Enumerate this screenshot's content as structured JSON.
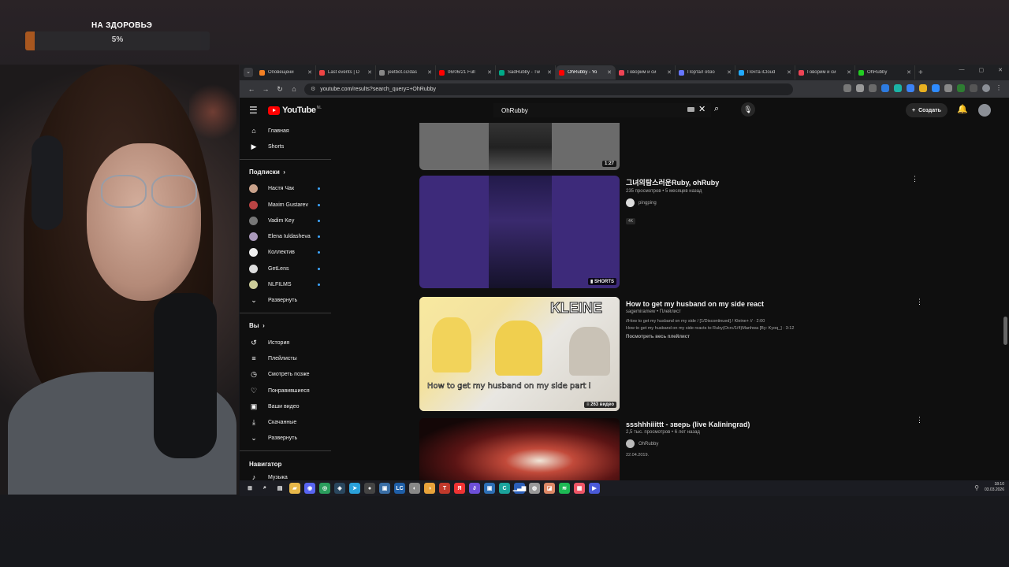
{
  "overlay": {
    "title": "НА ЗДОРОВЬЭ",
    "percent": "5%",
    "progress": 0.05,
    "accent": "#c9651e"
  },
  "browser": {
    "tabs": [
      {
        "label": "Оповещени",
        "color": "#f48024",
        "active": false
      },
      {
        "label": "Last events | D",
        "color": "#e44",
        "active": false
      },
      {
        "label": "jeetbot.cc/das",
        "color": "#888",
        "active": false
      },
      {
        "label": "06/06/21 Full",
        "color": "#f00",
        "active": false
      },
      {
        "label": "SadRubby - Tw",
        "color": "#0a8",
        "active": false
      },
      {
        "label": "OhRubby - Yo",
        "color": "#f00",
        "active": true
      },
      {
        "label": "Говорим и си",
        "color": "#e45",
        "active": false
      },
      {
        "label": "Портал обзо",
        "color": "#67f",
        "active": false
      },
      {
        "label": "Почта iCloud",
        "color": "#2af",
        "active": false
      },
      {
        "label": "Говорим и си",
        "color": "#e45",
        "active": false
      },
      {
        "label": "OhRubby",
        "color": "#2c2",
        "active": false
      }
    ],
    "url": "youtube.com/results?search_query=+OhRubby"
  },
  "youtube": {
    "logo": "YouTube",
    "region": "NL",
    "search_value": "OhRubby",
    "create_label": "Создать",
    "sidebar": {
      "top": [
        {
          "icon": "⌂",
          "label": "Главная"
        },
        {
          "icon": "▶",
          "label": "Shorts"
        }
      ],
      "subs_header": "Подписки",
      "subs": [
        {
          "label": "Настя Чак",
          "color": "#c9a28b"
        },
        {
          "label": "Maxim Gustarev",
          "color": "#b44"
        },
        {
          "label": "Vadim Key",
          "color": "#777"
        },
        {
          "label": "Elena Iuldasheva",
          "color": "#a9b"
        },
        {
          "label": "Коллектив",
          "color": "#eee"
        },
        {
          "label": "GetLens",
          "color": "#ddd"
        },
        {
          "label": "NLFILMS",
          "color": "#cc9"
        }
      ],
      "expand": "Развернуть",
      "you_header": "Вы",
      "you": [
        {
          "icon": "↺",
          "label": "История"
        },
        {
          "icon": "≡",
          "label": "Плейлисты"
        },
        {
          "icon": "◷",
          "label": "Смотреть позже"
        },
        {
          "icon": "♡",
          "label": "Понравившиеся"
        },
        {
          "icon": "▣",
          "label": "Ваши видео"
        },
        {
          "icon": "⤓",
          "label": "Скачанные"
        }
      ],
      "expand2": "Развернуть",
      "nav_header": "Навигатор",
      "nav_item": "Музыка"
    },
    "results": [
      {
        "duration": "1:27"
      },
      {
        "title": "그녀의탐스러운Ruby, ohRuby",
        "meta": "235 просмотров • 5 месяцев назад",
        "channel": "pingping",
        "badge": "4K",
        "duration": "SHORTS"
      },
      {
        "title": "How to get my husband on my side react",
        "meta": "sagemiramew • Плейлист",
        "line1": "//How to get my husband on my side / [1/Discontinued] / Kleine+ // · 2:00",
        "line2": "How to get my husband on my side reacts to Ruby(Ocrc/1/4)Manhwa [By: Kyoq_] · 3:12",
        "link": "Посмотреть весь плейлист",
        "duration": "263 видео",
        "thumb_text": "How to get my husband on my side part i",
        "thumb_brand": "KLEINE"
      },
      {
        "title": "ssshhhiiittt - зверь (live Kaliningrad)",
        "meta": "2,5 тыс. просмотров • 6 лет назад",
        "channel": "OhRubby",
        "date": "22.04.2019."
      }
    ]
  },
  "taskbar": {
    "icons": [
      {
        "name": "windows-start-icon",
        "glyph": "⊞",
        "bg": "#1b1c22"
      },
      {
        "name": "search-icon",
        "glyph": "⌕",
        "bg": "#1b1c22"
      },
      {
        "name": "task-view-icon",
        "glyph": "▤",
        "bg": "#1b1c22"
      },
      {
        "name": "explorer-icon",
        "glyph": "▰",
        "bg": "#e8b84a"
      },
      {
        "name": "discord-icon",
        "glyph": "◉",
        "bg": "#5865f2"
      },
      {
        "name": "chrome-icon",
        "glyph": "◎",
        "bg": "#2a9d5c"
      },
      {
        "name": "steam-icon",
        "glyph": "◈",
        "bg": "#2a475e"
      },
      {
        "name": "telegram-icon",
        "glyph": "➤",
        "bg": "#2aa1da"
      },
      {
        "name": "obs-icon",
        "glyph": "●",
        "bg": "#444"
      },
      {
        "name": "app-icon",
        "glyph": "▣",
        "bg": "#3a6ea5"
      },
      {
        "name": "lc-icon",
        "glyph": "LC",
        "bg": "#1f5fa8"
      },
      {
        "name": "app2-icon",
        "glyph": "◐",
        "bg": "#888"
      },
      {
        "name": "app3-icon",
        "glyph": "◑",
        "bg": "#e8a33a"
      },
      {
        "name": "twitch-icon",
        "glyph": "T",
        "bg": "#c0392b"
      },
      {
        "name": "yandex-icon",
        "glyph": "Я",
        "bg": "#e33"
      },
      {
        "name": "app4-icon",
        "glyph": "∂",
        "bg": "#6d4fd8"
      },
      {
        "name": "app5-icon",
        "glyph": "▣",
        "bg": "#2d6fb5"
      },
      {
        "name": "app6-icon",
        "glyph": "C",
        "bg": "#1ba39c"
      },
      {
        "name": "stats-icon",
        "glyph": "▁▃▆",
        "bg": "#2b5fb9"
      },
      {
        "name": "app7-icon",
        "glyph": "◍",
        "bg": "#999"
      },
      {
        "name": "photos-icon",
        "glyph": "◪",
        "bg": "#d86"
      },
      {
        "name": "spotify-icon",
        "glyph": "≋",
        "bg": "#1db954"
      },
      {
        "name": "app8-icon",
        "glyph": "▦",
        "bg": "#e56"
      },
      {
        "name": "app9-icon",
        "glyph": "▶",
        "bg": "#4a5ad8"
      }
    ],
    "time": "18:10",
    "date": "03.03.2026"
  }
}
